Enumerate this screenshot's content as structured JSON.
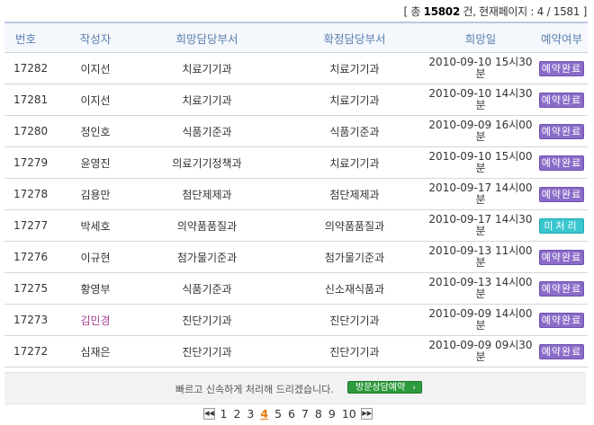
{
  "summary": {
    "open": "[ 총 ",
    "total": "15802",
    "middle": " 건, 현재페이지 : 4 / 1581 ]"
  },
  "headers": [
    "번호",
    "작성자",
    "희망담당부서",
    "확정담당부서",
    "희망일",
    "예약여부"
  ],
  "rows": [
    {
      "no": "17282",
      "writer": "이지선",
      "want_dept": "치료기기과",
      "fixed_dept": "치료기기과",
      "date1": "2010-09-10 15시30",
      "date2": "분",
      "status": "예약완료",
      "status_type": "done"
    },
    {
      "no": "17281",
      "writer": "이지선",
      "want_dept": "치료기기과",
      "fixed_dept": "치료기기과",
      "date1": "2010-09-10 14시30",
      "date2": "분",
      "status": "예약완료",
      "status_type": "done"
    },
    {
      "no": "17280",
      "writer": "정인호",
      "want_dept": "식품기준과",
      "fixed_dept": "식품기준과",
      "date1": "2010-09-09 16시00",
      "date2": "분",
      "status": "예약완료",
      "status_type": "done"
    },
    {
      "no": "17279",
      "writer": "윤영진",
      "want_dept": "의료기기정책과",
      "fixed_dept": "치료기기과",
      "date1": "2010-09-10 15시00",
      "date2": "분",
      "status": "예약완료",
      "status_type": "done"
    },
    {
      "no": "17278",
      "writer": "김용만",
      "want_dept": "첨단제제과",
      "fixed_dept": "첨단제제과",
      "date1": "2010-09-17 14시00",
      "date2": "분",
      "status": "예약완료",
      "status_type": "done"
    },
    {
      "no": "17277",
      "writer": "박세호",
      "want_dept": "의약품품질과",
      "fixed_dept": "의약품품질과",
      "date1": "2010-09-17 14시30",
      "date2": "분",
      "status": "미처리",
      "status_type": "pend"
    },
    {
      "no": "17276",
      "writer": "이규현",
      "want_dept": "첨가물기준과",
      "fixed_dept": "첨가물기준과",
      "date1": "2010-09-13 11시00",
      "date2": "분",
      "status": "예약완료",
      "status_type": "done"
    },
    {
      "no": "17275",
      "writer": "황영부",
      "want_dept": "식품기준과",
      "fixed_dept": "신소재식품과",
      "date1": "2010-09-13 14시00",
      "date2": "분",
      "status": "예약완료",
      "status_type": "done"
    },
    {
      "no": "17273",
      "writer": "김민경",
      "want_dept": "진단기기과",
      "fixed_dept": "진단기기과",
      "date1": "2010-09-09 14시00",
      "date2": "분",
      "status": "예약완료",
      "status_type": "done",
      "writer_color": "#a63f8f"
    },
    {
      "no": "17272",
      "writer": "심재은",
      "want_dept": "진단기기과",
      "fixed_dept": "진단기기과",
      "date1": "2010-09-09 09시30",
      "date2": "분",
      "status": "예약완료",
      "status_type": "done"
    }
  ],
  "banner": {
    "message": "빠르고 신속하게 처리해 드리겠습니다.",
    "button": "방문상담예약",
    "button_arrow": "›"
  },
  "pager": {
    "first_icon": "double-left-arrow-icon",
    "last_icon": "double-right-arrow-icon",
    "first_glyph": "◀◀",
    "last_glyph": "▶▶",
    "pages": [
      "1",
      "2",
      "3",
      "4",
      "5",
      "6",
      "7",
      "8",
      "9",
      "10"
    ],
    "current": "4"
  },
  "colors": {
    "header_text": "#5b7fb0",
    "status_done": "#8a6cc8",
    "status_pending": "#39c6cf",
    "current_page": "#e87800",
    "button_green": "#2d9a3e"
  }
}
